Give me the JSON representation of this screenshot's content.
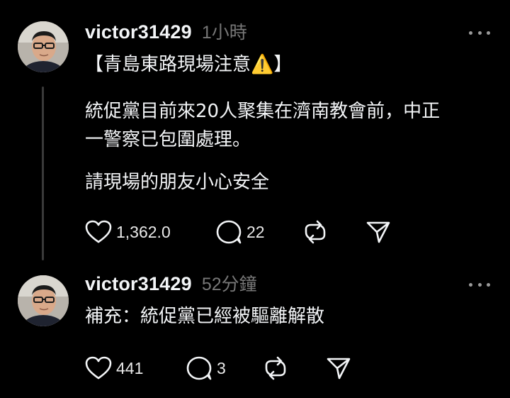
{
  "posts": [
    {
      "username": "victor31429",
      "timestamp": "1小時",
      "lines": [
        "【青島東路現場注意⚠️】",
        "統促黨目前來20人聚集在濟南教會前，中正",
        "一警察已包圍處理。",
        "請現場的朋友小心安全"
      ],
      "likes": "1,362.0",
      "comments": "22",
      "icons": {
        "like": "heart-icon",
        "comment": "comment-icon",
        "repost": "repost-icon",
        "share": "send-icon",
        "more": "more-icon"
      }
    },
    {
      "username": "victor31429",
      "timestamp": "52分鐘",
      "lines": [
        "補充：統促黨已經被驅離解散"
      ],
      "likes": "441",
      "comments": "3",
      "icons": {
        "like": "heart-icon",
        "comment": "comment-icon",
        "repost": "repost-icon",
        "share": "send-icon",
        "more": "more-icon"
      }
    }
  ],
  "colors": {
    "background": "#000000",
    "text": "#f3f5f7",
    "muted": "#777777",
    "thread_line": "#3a3a3a"
  }
}
